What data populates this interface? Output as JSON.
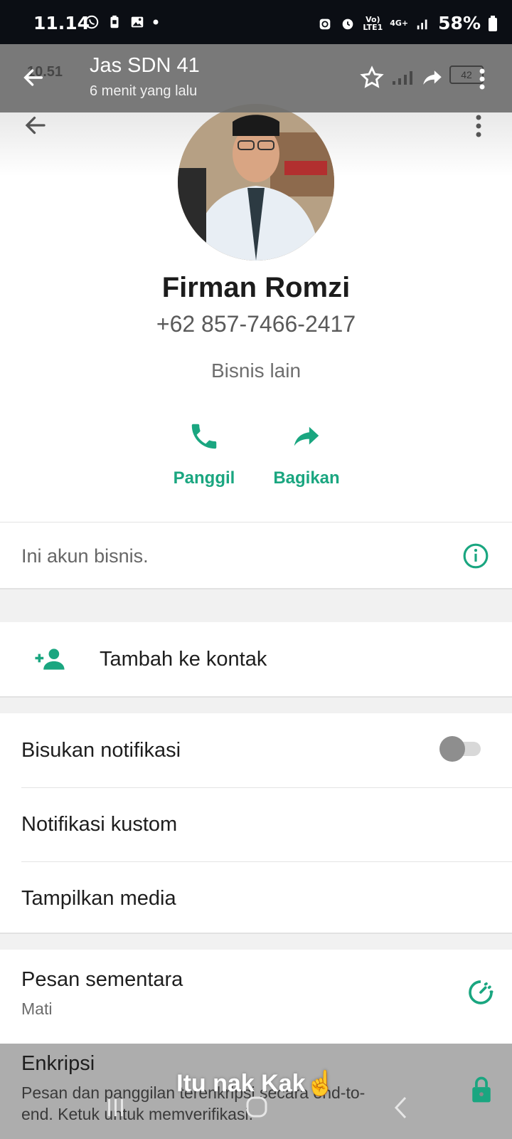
{
  "status_bar": {
    "time": "11.14",
    "network": "4G+",
    "battery": "58%"
  },
  "overlay_header": {
    "ghost_time": "10.51",
    "title": "Jas SDN 41",
    "subtitle": "6 menit yang lalu",
    "battery_badge": "42"
  },
  "profile": {
    "name": "Firman Romzi",
    "phone": "+62 857-7466-2417",
    "category": "Bisnis lain"
  },
  "actions": {
    "call_label": "Panggil",
    "share_label": "Bagikan"
  },
  "business_info": {
    "text": "Ini akun bisnis."
  },
  "add_contact": {
    "label": "Tambah ke kontak"
  },
  "settings": {
    "mute_label": "Bisukan notifikasi",
    "mute_on": false,
    "custom_notif_label": "Notifikasi kustom",
    "media_label": "Tampilkan media",
    "disappearing_label": "Pesan sementara",
    "disappearing_value": "Mati",
    "encryption_label": "Enkripsi",
    "encryption_desc": "Pesan dan panggilan terenkripsi secara end-to-end. Ketuk untuk memverifikasi."
  },
  "caption": "Itu nak Kak☝️",
  "colors": {
    "accent": "#1aa680",
    "status_bar": "#0b0e14"
  },
  "icons": {
    "back": "back-arrow-icon",
    "more": "more-vert-icon",
    "call": "phone-icon",
    "share": "share-icon",
    "info": "info-icon",
    "add_person": "person-add-icon",
    "timer": "timer-icon",
    "lock": "lock-icon"
  }
}
